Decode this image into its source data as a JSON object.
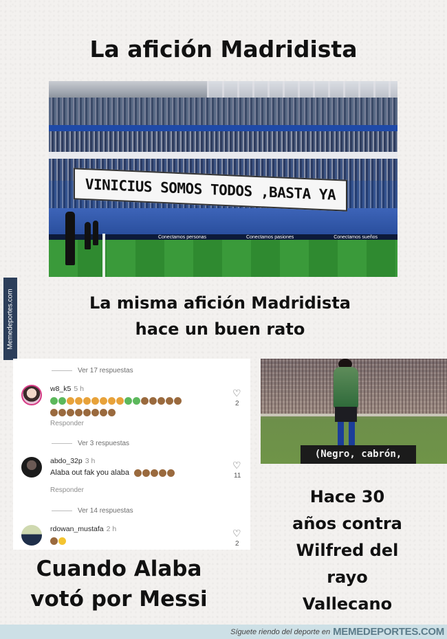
{
  "titles": {
    "top": "La afición Madridista",
    "middle_line1": "La misma afición Madridista",
    "middle_line2": "hace un buen rato",
    "right_lines": [
      "Hace 30",
      "años contra",
      "Wilfred del",
      "rayo",
      "Vallecano"
    ],
    "left_line1": "Cuando Alaba",
    "left_line2": "votó por Messi"
  },
  "stadium_photo": {
    "banner_text": "VINICIUS SOMOS TODOS ,BASTA YA",
    "ads": [
      "Conectamos personas",
      "Conectamos pasiones",
      "Conectamos sueños"
    ]
  },
  "comments": {
    "threads": [
      {
        "replies_label": "Ver 17 respuestas",
        "user": "w8_k5",
        "time": "5 h",
        "text": "",
        "emoji_row1": [
          "sick",
          "sick",
          "nausea",
          "nausea",
          "nausea",
          "nausea",
          "nausea",
          "nausea",
          "nausea",
          "sick",
          "sick",
          "monkey",
          "monkey",
          "monkey",
          "monkey",
          "monkey"
        ],
        "emoji_row2": [
          "monkey",
          "monkey",
          "monkey",
          "monkey",
          "monkey",
          "monkey",
          "monkey",
          "monkey"
        ],
        "reply_label": "Responder",
        "likes": "2"
      },
      {
        "replies_label": "Ver 3 respuestas",
        "user": "abdo_32p",
        "time": "3 h",
        "text": "Alaba out fak you alaba",
        "emoji_row1": [
          "monkey",
          "monkey",
          "monkey",
          "monkey",
          "monkey"
        ],
        "reply_label": "Responder",
        "likes": "11"
      },
      {
        "replies_label": "Ver 14 respuestas",
        "user": "rdowan_mustafa",
        "time": "2 h",
        "text": "",
        "emoji_row1": [
          "monkey",
          "laughing"
        ],
        "likes": "2"
      }
    ]
  },
  "vintage_photo": {
    "subtitle": "(Negro, cabrón,"
  },
  "watermark": {
    "side": "Memedeportes.com",
    "footer_tagline": "Síguete riendo del deporte en",
    "footer_brand": "MEMEDEPORTES.COM"
  },
  "colors": {
    "emoji_sick": "#5cb85c",
    "emoji_nausea": "#e8a23a",
    "emoji_monkey": "#9a6a3e",
    "emoji_laughing": "#f4c430",
    "footer_bg": "#cde0e6"
  }
}
